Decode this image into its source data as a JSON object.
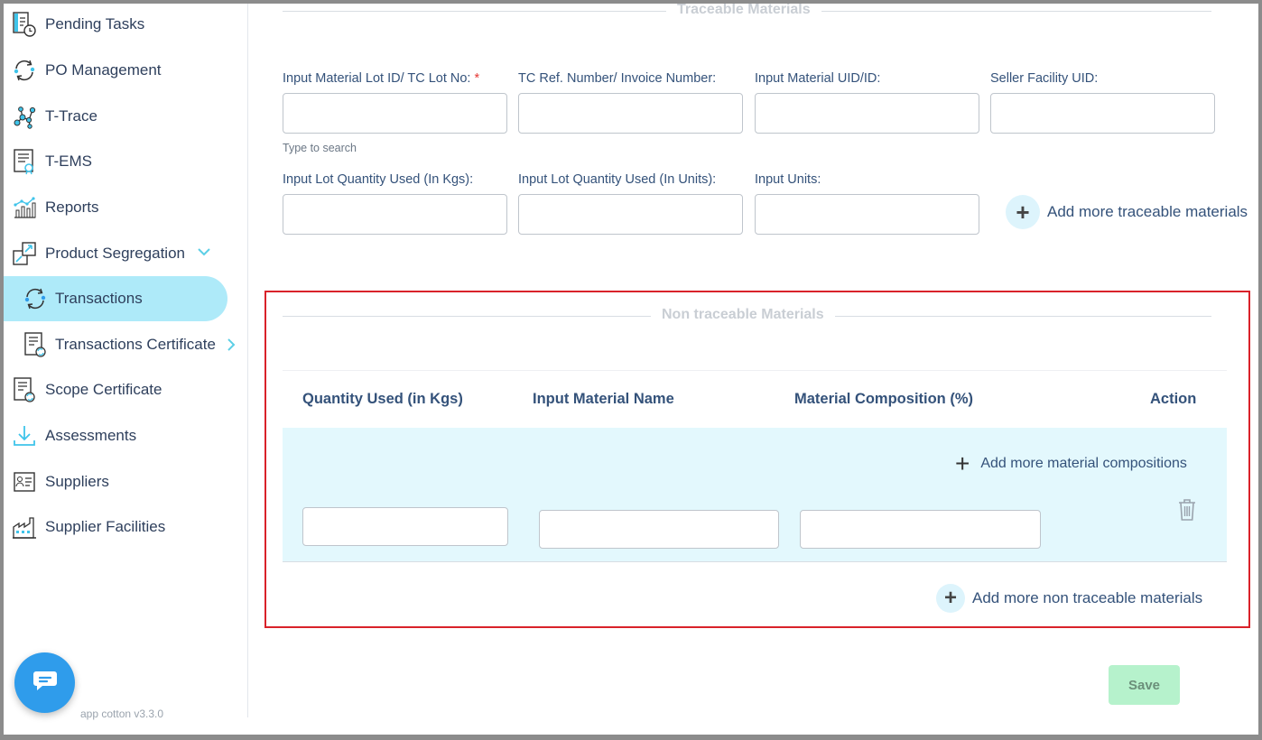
{
  "sidebar": {
    "items": [
      {
        "label": "Pending Tasks",
        "icon": "pending-tasks-icon"
      },
      {
        "label": "PO Management",
        "icon": "po-management-icon"
      },
      {
        "label": "T-Trace",
        "icon": "t-trace-icon"
      },
      {
        "label": "T-EMS",
        "icon": "t-ems-icon"
      },
      {
        "label": "Reports",
        "icon": "reports-icon"
      },
      {
        "label": "Product Segregation",
        "icon": "product-segregation-icon",
        "expanded": true
      },
      {
        "label": "Transactions",
        "icon": "transactions-icon",
        "active": true
      },
      {
        "label": "Transactions Certificate",
        "icon": "transactions-certificate-icon"
      },
      {
        "label": "Scope Certificate",
        "icon": "scope-certificate-icon"
      },
      {
        "label": "Assessments",
        "icon": "assessments-icon"
      },
      {
        "label": "Suppliers",
        "icon": "suppliers-icon"
      },
      {
        "label": "Supplier Facilities",
        "icon": "supplier-facilities-icon"
      }
    ],
    "version": "app cotton v3.3.0"
  },
  "traceable": {
    "title": "Traceable Materials",
    "fields": {
      "lot_id_label": "Input Material Lot ID/ TC Lot No:",
      "required_mark": "*",
      "lot_id_hint": "Type to search",
      "tc_ref_label": "TC Ref. Number/ Invoice Number:",
      "uid_label": "Input Material UID/ID:",
      "seller_label": "Seller Facility UID:",
      "qty_kgs_label": "Input Lot Quantity Used (In Kgs):",
      "qty_units_label": "Input Lot Quantity Used (In Units):",
      "units_label": "Input Units:"
    },
    "add_more": "Add more traceable materials"
  },
  "non_traceable": {
    "title": "Non traceable Materials",
    "columns": [
      "Quantity Used (in Kgs)",
      "Input Material Name",
      "Material Composition (%)",
      "Action"
    ],
    "add_compositions": "Add more material compositions",
    "add_more": "Add more non traceable materials"
  },
  "actions": {
    "save": "Save"
  },
  "colors": {
    "accent": "#aeeaf9",
    "highlight_border": "#d9222a",
    "row_bg": "#e3f8fd",
    "save_bg": "#b6f2cc",
    "chat": "#2f9ceb"
  }
}
